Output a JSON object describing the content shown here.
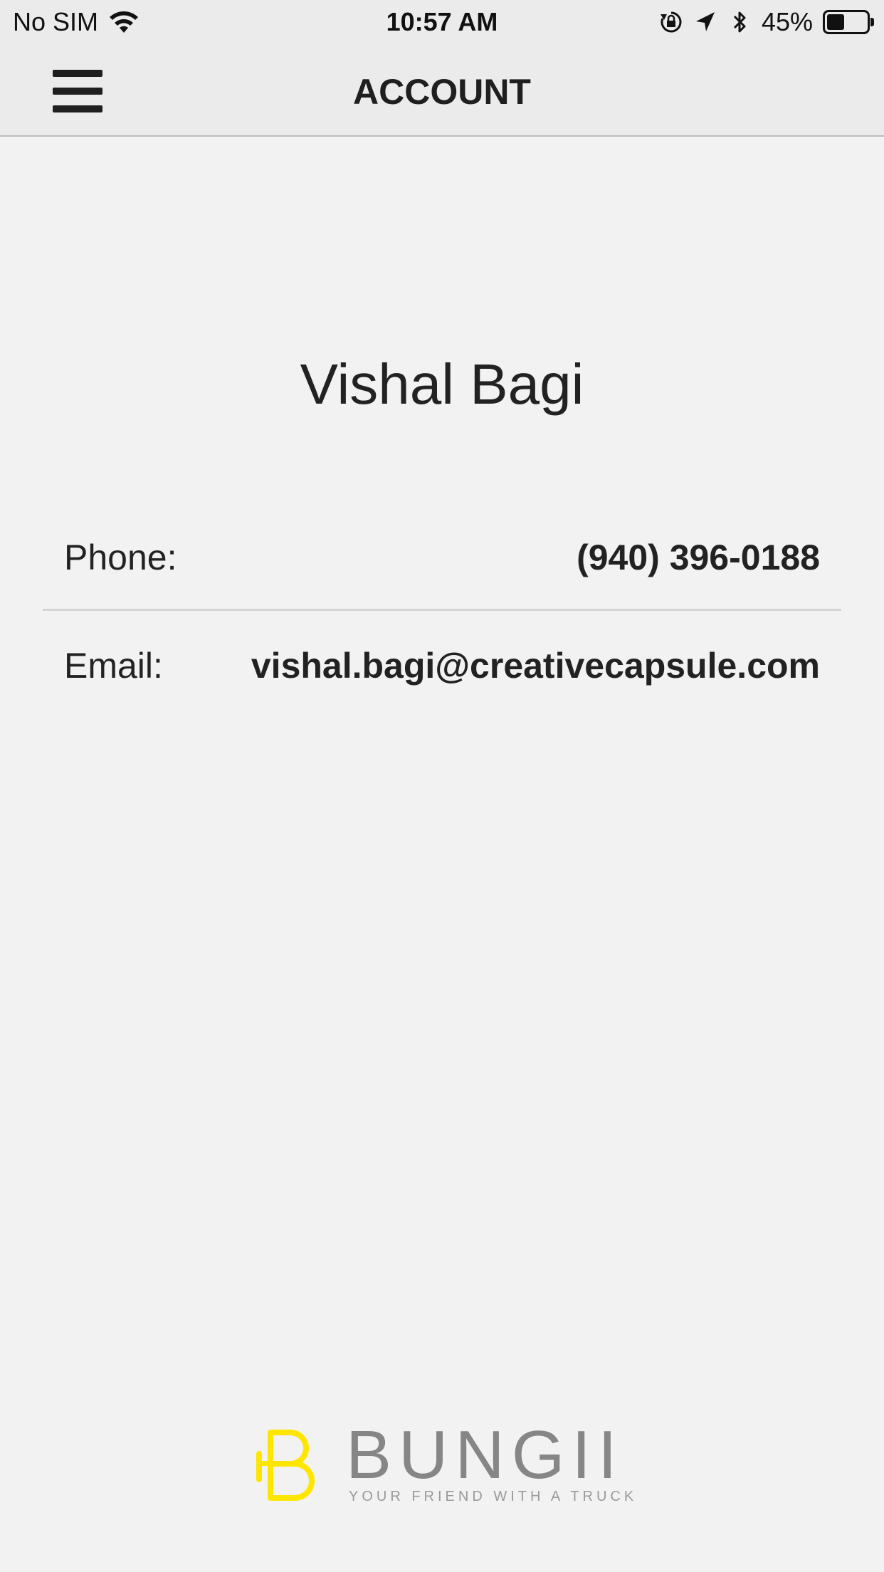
{
  "status_bar": {
    "carrier": "No SIM",
    "time": "10:57 AM",
    "battery_percent": "45%",
    "battery_level": 0.45,
    "icons": [
      "wifi-icon",
      "rotation-lock-icon",
      "location-arrow-icon",
      "bluetooth-icon",
      "battery-icon"
    ]
  },
  "nav": {
    "title": "ACCOUNT",
    "menu_icon": "hamburger-menu-icon"
  },
  "profile": {
    "name": "Vishal Bagi",
    "phone_label": "Phone:",
    "phone_value": "(940) 396-0188",
    "email_label": "Email:",
    "email_value": "vishal.bagi@creativecapsule.com"
  },
  "brand": {
    "name": "BUNGII",
    "tagline": "YOUR FRIEND WITH A TRUCK",
    "accent_color": "#ffe600",
    "word_color": "#868686"
  }
}
